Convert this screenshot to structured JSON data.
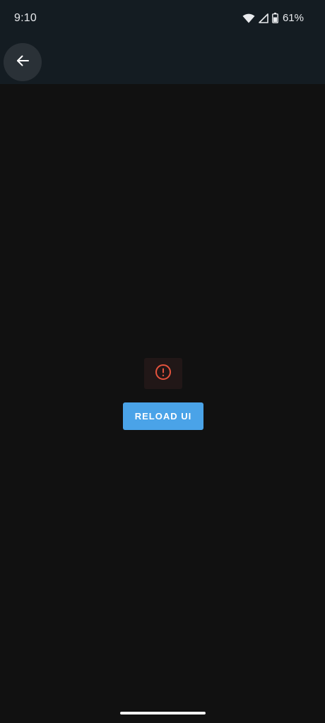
{
  "status_bar": {
    "time": "9:10",
    "battery_percent": "61%",
    "icons": [
      "wifi-icon",
      "cell-signal-icon",
      "battery-icon"
    ]
  },
  "toolbar": {
    "back_icon": "arrow-left-icon"
  },
  "error": {
    "icon": "error-circle-icon",
    "icon_color": "#e5533d"
  },
  "actions": {
    "reload_label": "RELOAD UI",
    "reload_color": "#4aa3e8"
  }
}
